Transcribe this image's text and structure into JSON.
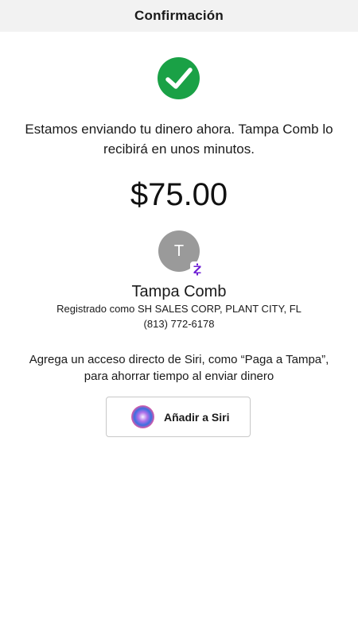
{
  "header": {
    "title": "Confirmación"
  },
  "confirmation": {
    "message": "Estamos enviando tu dinero ahora. Tampa Comb lo recibirá en unos minutos.",
    "amount": "$75.00"
  },
  "recipient": {
    "initial": "T",
    "name": "Tampa Comb",
    "registered": "Registrado como SH SALES CORP, PLANT CITY, FL",
    "phone": "(813) 772-6178",
    "badge_icon": "zelle-icon"
  },
  "siri": {
    "prompt": "Agrega un acceso directo de Siri, como “Paga a Tampa”, para ahorrar tiempo al enviar dinero",
    "button_label": "Añadir a Siri",
    "icon": "siri-icon"
  },
  "colors": {
    "success": "#1aa146",
    "avatar": "#9a9a9a",
    "zelle_purple": "#6d1ed4"
  }
}
